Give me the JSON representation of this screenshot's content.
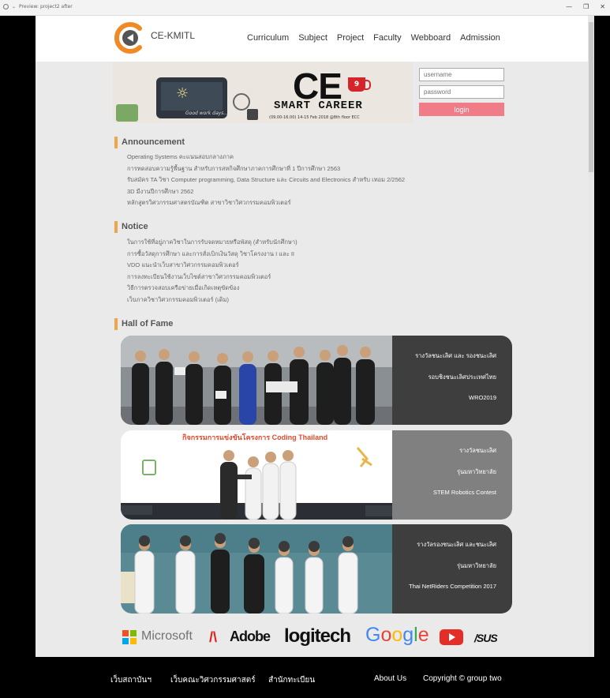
{
  "window": {
    "title": "Preview: project2 after"
  },
  "header": {
    "brand": "CE-KMITL",
    "nav": [
      "Curriculum",
      "Subject",
      "Project",
      "Faculty",
      "Webboard",
      "Admission"
    ]
  },
  "banner": {
    "headline": "CE",
    "edition": "9",
    "subtitle": "SMART CAREER",
    "date": "(09.00-16.00) 14-15 Feb 2018 @8th floor ECC",
    "screen_text": "Good work days..."
  },
  "login": {
    "username_placeholder": "username",
    "password_placeholder": "password",
    "button_label": "login"
  },
  "announcement": {
    "title": "Announcement",
    "items": [
      "Operating Systems คะแนนสอบกลางภาค",
      "การทดสอบความรู้พื้นฐาน สำหรับการสหกิจศึกษาภาคการศึกษาที่ 1 ปีการศึกษา 2563",
      "รับสมัคร TA วิชา Computer programming, Data Structure และ Circuits and Electronics สำหรับ เทอม 2/2562",
      "3D มีงานปีการศึกษา 2562",
      "หลักสูตรวิศวกรรมศาสตรบัณฑิต สาขาวิชาวิศวกรรมคอมพิวเตอร์"
    ]
  },
  "notice": {
    "title": "Notice",
    "items": [
      "ในการใช้ที่อยู่ภาควิชาในการรับจดหมายหรือพัสดุ (สำหรับนักศึกษา)",
      "การซื้อวัสดุการศึกษา และการสั่งเบิกเงินวัสดุ วิชาโครงงาน I และ II",
      "VDO แนะนำเว็บสาขาวิศวกรรมคอมพิวเตอร์",
      "การลงทะเบียนใช้งานเว็บไซต์สาขาวิศวกรรมคอมพิวเตอร์",
      "วิธีการตรวจสอบเครือข่ายเมื่อเกิดเหตุขัดข้อง",
      "เว็บภาควิชาวิศวกรรมคอมพิวเตอร์ (เดิม)"
    ]
  },
  "hall_of_fame": {
    "title": "Hall of Fame",
    "cards": [
      {
        "lines": [
          "รางวัลชนะเลิศ และ รองชนะเลิศ",
          "รอบชิงชนะเลิศประเทศไทย",
          "WRO2019"
        ],
        "caption_bg": "#3e3e3e"
      },
      {
        "lines": [
          "รางวัลชนะเลิศ",
          "รุ่นมหาวิทยาลัย",
          "STEM Robotics Contest"
        ],
        "caption_bg": "#808080",
        "photo_banner": "กิจกรรมการแข่งขันโครงการ Coding Thailand"
      },
      {
        "lines": [
          "รางวัลรองชนะเลิศ และชนะเลิศ",
          "รุ่นมหาวิทยาลัย",
          "Thai NetRiders Competition 2017"
        ],
        "caption_bg": "#3e3e3e"
      }
    ]
  },
  "sponsors": {
    "microsoft": "Microsoft",
    "adobe": "Adobe",
    "logitech": "logitech",
    "google": [
      "G",
      "o",
      "o",
      "g",
      "l",
      "e"
    ],
    "asus": "/SUS"
  },
  "footer": {
    "links": [
      "เว็บสถาบันฯ",
      "เว็บคณะวิศวกรรมศาสตร์",
      "สำนักทะเบียน"
    ],
    "about": "About Us",
    "copyright": "Copyright © group two"
  }
}
